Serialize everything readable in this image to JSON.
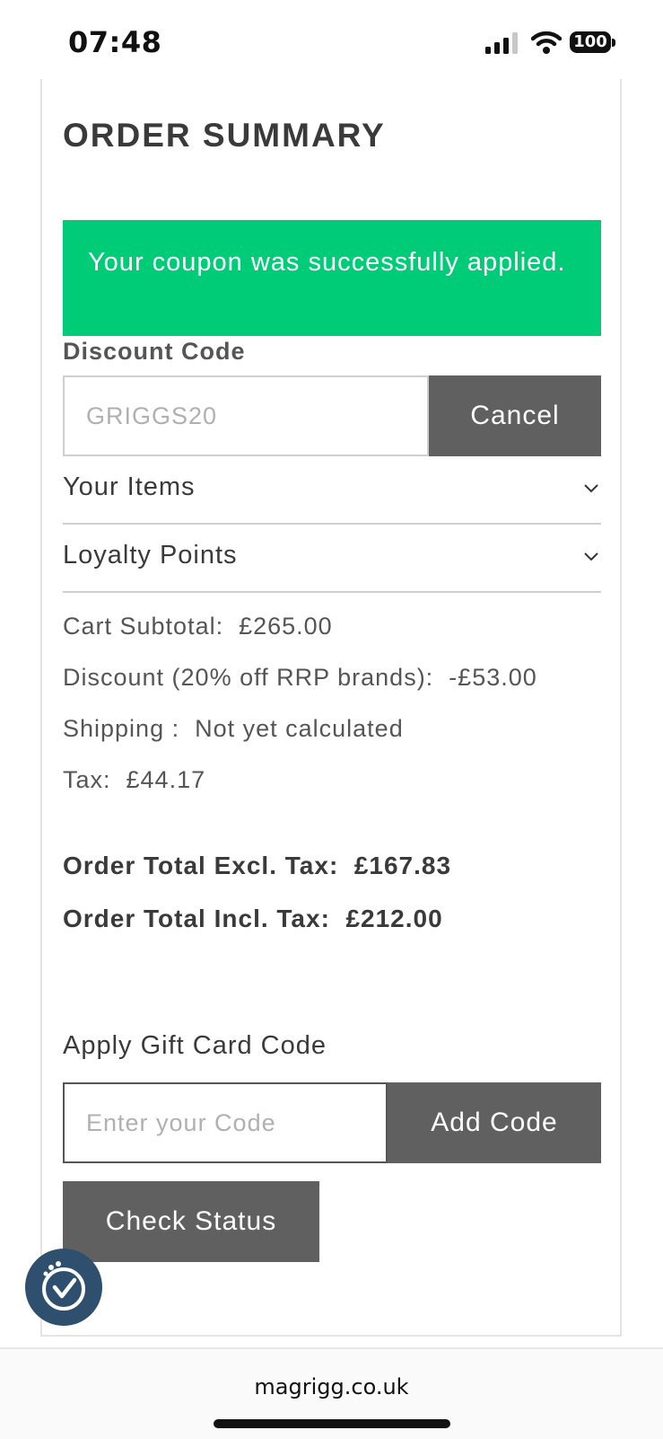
{
  "status_bar": {
    "time": "07:48",
    "battery": "100"
  },
  "summary": {
    "title": "ORDER SUMMARY",
    "success_message": "Your coupon was successfully applied.",
    "discount_label": "Discount Code",
    "discount_value": "GRIGGS20",
    "cancel_label": "Cancel",
    "accordion": [
      {
        "label": "Your Items"
      },
      {
        "label": "Loyalty Points"
      }
    ],
    "lines": {
      "subtotal": "Cart Subtotal:  £265.00",
      "discount": "Discount (20% off RRP brands):  -£53.00",
      "shipping": "Shipping :  Not yet calculated",
      "tax": "Tax:  £44.17"
    },
    "totals": {
      "excl": "Order Total Excl. Tax:  £167.83",
      "incl": "Order Total Incl. Tax:  £212.00"
    }
  },
  "gift_card": {
    "label": "Apply Gift Card Code",
    "placeholder": "Enter your Code",
    "add_label": "Add Code",
    "check_label": "Check Status"
  },
  "browser": {
    "url": "magrigg.co.uk"
  },
  "colors": {
    "success": "#00cc77",
    "button": "#606060",
    "fab": "#2e4f6e"
  }
}
